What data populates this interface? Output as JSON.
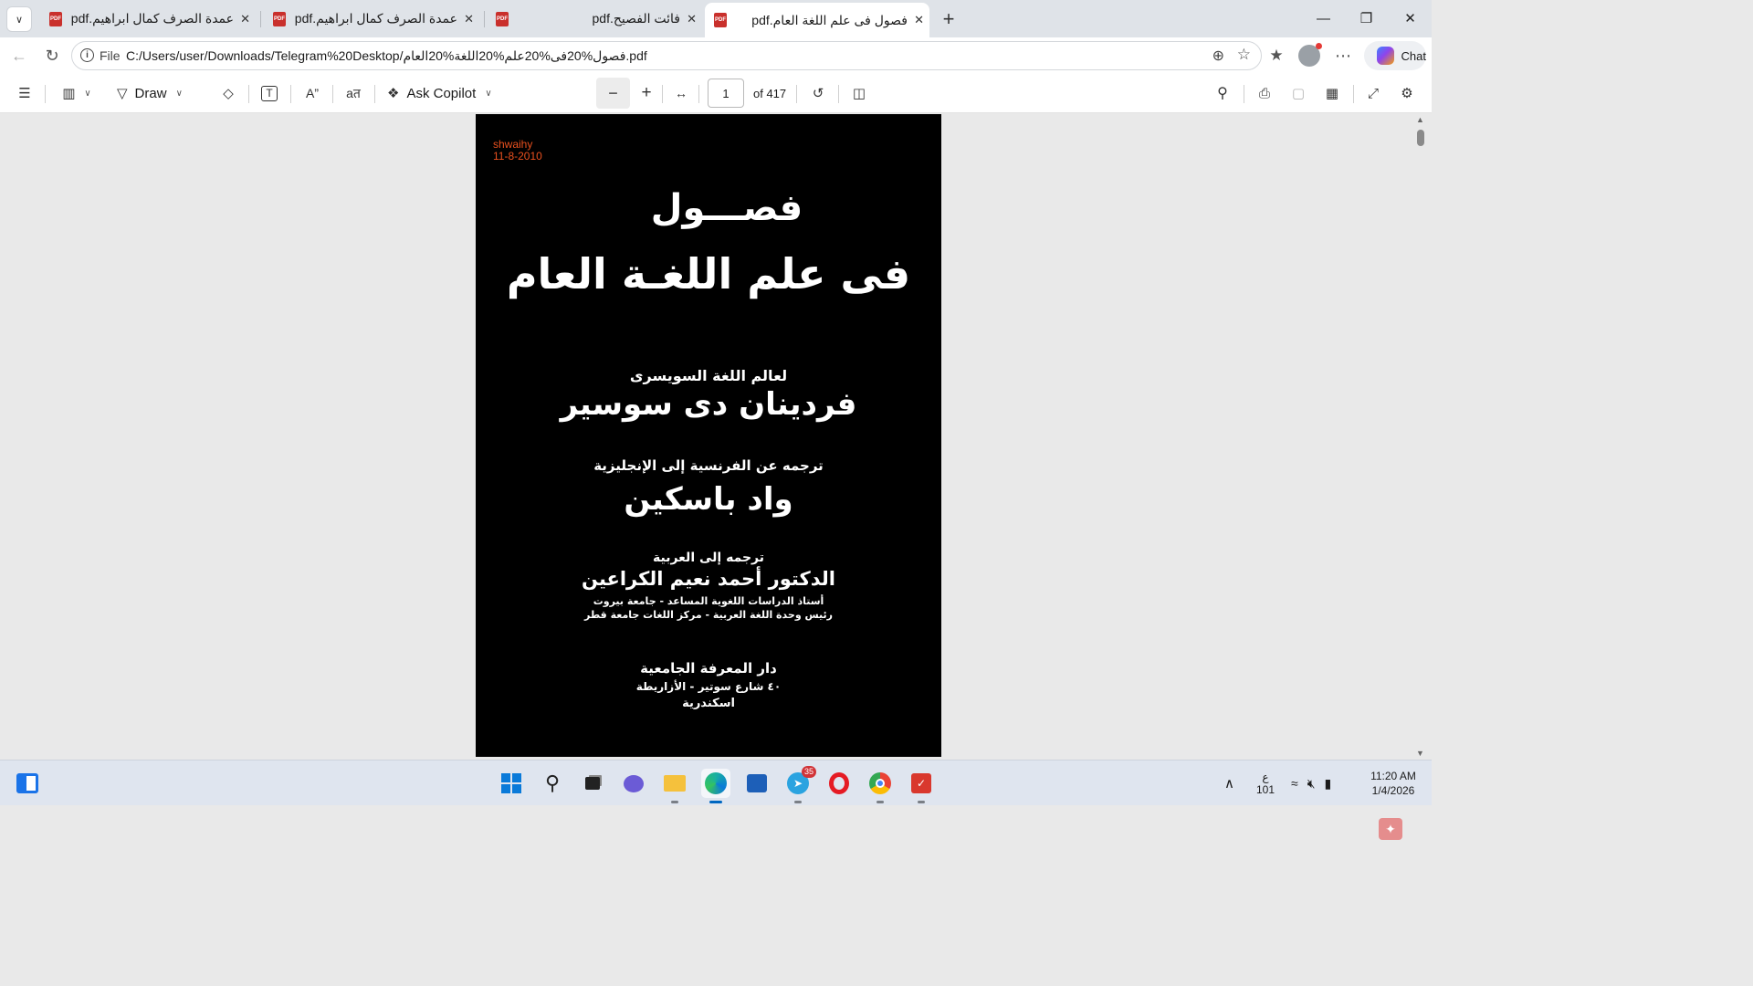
{
  "tabs": [
    {
      "title": "عمدة الصرف كمال ابراهيم.pdf",
      "icon": "pdf-icon",
      "active": false
    },
    {
      "title": "عمدة الصرف كمال ابراهيم.pdf",
      "icon": "pdf-icon",
      "active": false
    },
    {
      "title": "فائت الفصيح.pdf",
      "icon": "pdf-icon",
      "active": false
    },
    {
      "title": "فصول فى علم اللغة العام.pdf",
      "icon": "pdf-icon",
      "active": true
    }
  ],
  "address": {
    "scheme": "File",
    "url": "C:/Users/user/Downloads/Telegram%20Desktop/فصول%20فى%20علم%20اللغة%20العام.pdf"
  },
  "chat": {
    "label": "Chat"
  },
  "pdf_toolbar": {
    "draw_label": "Draw",
    "copilot_label": "Ask Copilot",
    "page_number": "1",
    "page_count": "of 417"
  },
  "document": {
    "stamp_name": "shwaihy",
    "stamp_date": "11-8-2010",
    "title_line1": "فصـــول",
    "title_line2": "فى علم اللغـة العام",
    "author_prefix": "لعالم اللغة السويسرى",
    "author": "فردينان دى سوسير",
    "translation_prefix": "ترجمه عن الفرنسية إلى الإنجليزية",
    "translator": "واد باسكين",
    "arabic_prefix": "ترجمه إلى العربية",
    "arabic_translator": "الدكتور أحمد نعيم الكراعين",
    "role1": "أستاذ الدراسات اللغوية المساعد - جامعة بيروت",
    "role2": "رئيس وحدة اللغة العربية - مركز اللغات جامعة قطر",
    "publisher": "دار المعرفة الجامعية",
    "publisher_address": "٤٠ شارع سوتير - الأزاريطة",
    "publisher_city": "اسكندرية"
  },
  "taskbar": {
    "telegram_badge": "35",
    "lang_top": "ع",
    "lang_bottom": "101",
    "time": "11:20 AM",
    "date": "1/4/2026"
  },
  "colors": {
    "stamp": "#e8501e",
    "page": "#000000",
    "active_indicator": "#0067c0"
  }
}
